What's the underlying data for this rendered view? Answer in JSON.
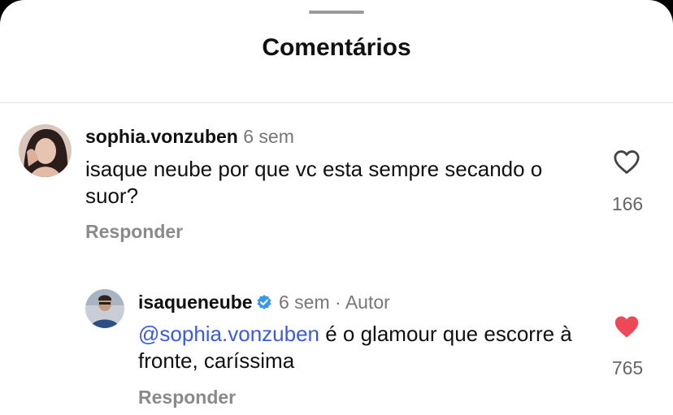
{
  "header": {
    "title": "Comentários"
  },
  "comments": [
    {
      "username": "sophia.vonzuben",
      "time": "6 sem",
      "text": "isaque neube por que vc esta sempre secando o suor?",
      "reply_label": "Responder",
      "likes": "166",
      "liked": false
    },
    {
      "username": "isaqueneube",
      "verified": true,
      "time": "6 sem",
      "separator": "·",
      "author_tag": "Autor",
      "mention": "@sophia.vonzuben",
      "text": "é o glamour que escorre à fronte, caríssima",
      "reply_label": "Responder",
      "likes": "765",
      "liked": true
    }
  ],
  "colors": {
    "like_active": "#ed4956",
    "mention": "#3b5bdb",
    "verified": "#3897f0"
  }
}
